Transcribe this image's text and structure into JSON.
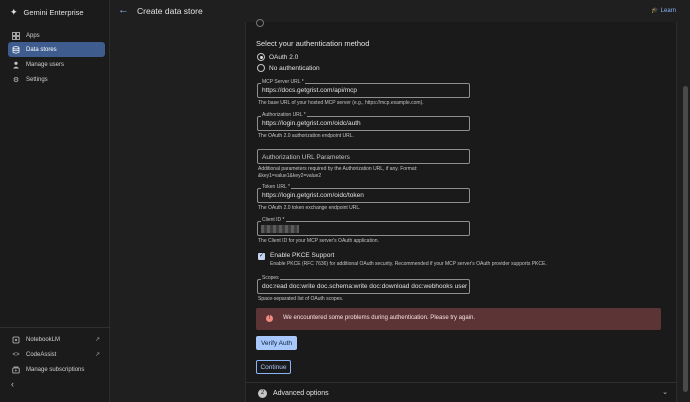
{
  "app": {
    "name": "Gemini Enterprise",
    "logo_icon": "sparkle-icon"
  },
  "sidebar": {
    "items": [
      {
        "label": "Apps",
        "icon": "grid-icon",
        "active": false
      },
      {
        "label": "Data stores",
        "icon": "database-icon",
        "active": true
      },
      {
        "label": "Manage users",
        "icon": "person-icon",
        "active": false
      },
      {
        "label": "Settings",
        "icon": "gear-icon",
        "active": false
      }
    ],
    "bottom_items": [
      {
        "label": "NotebookLM",
        "icon": "notebook-icon",
        "external": true
      },
      {
        "label": "CodeAssist",
        "icon": "code-icon",
        "external": true
      },
      {
        "label": "Manage subscriptions",
        "icon": "subscriptions-icon",
        "external": false
      }
    ]
  },
  "header": {
    "title": "Create data store",
    "learn_label": "Learn"
  },
  "form": {
    "auth_section_title": "Select your authentication method",
    "auth_options": [
      {
        "label": "OAuth 2.0",
        "selected": true
      },
      {
        "label": "No authentication",
        "selected": false
      }
    ],
    "fields": {
      "mcp_server_url": {
        "label": "MCP Server URL *",
        "value": "https://docs.getgrist.com/api/mcp",
        "help": "The base URL of your hosted MCP server (e.g., https://mcp.example.com)."
      },
      "authorization_url": {
        "label": "Authorization URL *",
        "value": "https://login.getgrist.com/oidc/auth",
        "help": "The OAuth 2.0 authorization endpoint URL."
      },
      "authorization_params": {
        "placeholder": "Authorization URL Parameters",
        "help_line1": "Additional parameters required by the Authorization URL, if any. Format:",
        "help_line2": "&key1=value1&key2=value2"
      },
      "token_url": {
        "label": "Token URL *",
        "value": "https://login.getgrist.com/oidc/token",
        "help": "The OAuth 2.0 token exchange endpoint URL."
      },
      "client_id": {
        "label": "Client ID *",
        "help": "The Client ID for your MCP server's OAuth application."
      },
      "scopes": {
        "label": "Scopes",
        "value": "doc:read doc:write doc.schema:write doc:download doc:webhooks user.profile",
        "help": "Space-separated list of OAuth scopes."
      }
    },
    "pkce": {
      "checked": true,
      "label": "Enable PKCE Support",
      "description": "Enable PKCE (RFC 7636) for additional OAuth security. Recommended if your MCP server's OAuth provider supports PKCE."
    },
    "error_message": "We encountered some problems during authentication. Please try again.",
    "verify_button": "Verify Auth",
    "continue_button": "Continue"
  },
  "advanced": {
    "step": "2",
    "label": "Advanced options"
  },
  "colors": {
    "accent": "#a8c7fa",
    "active_nav": "#3f5c8f",
    "error_bg": "#5c3436",
    "error_icon": "#f28b82"
  }
}
